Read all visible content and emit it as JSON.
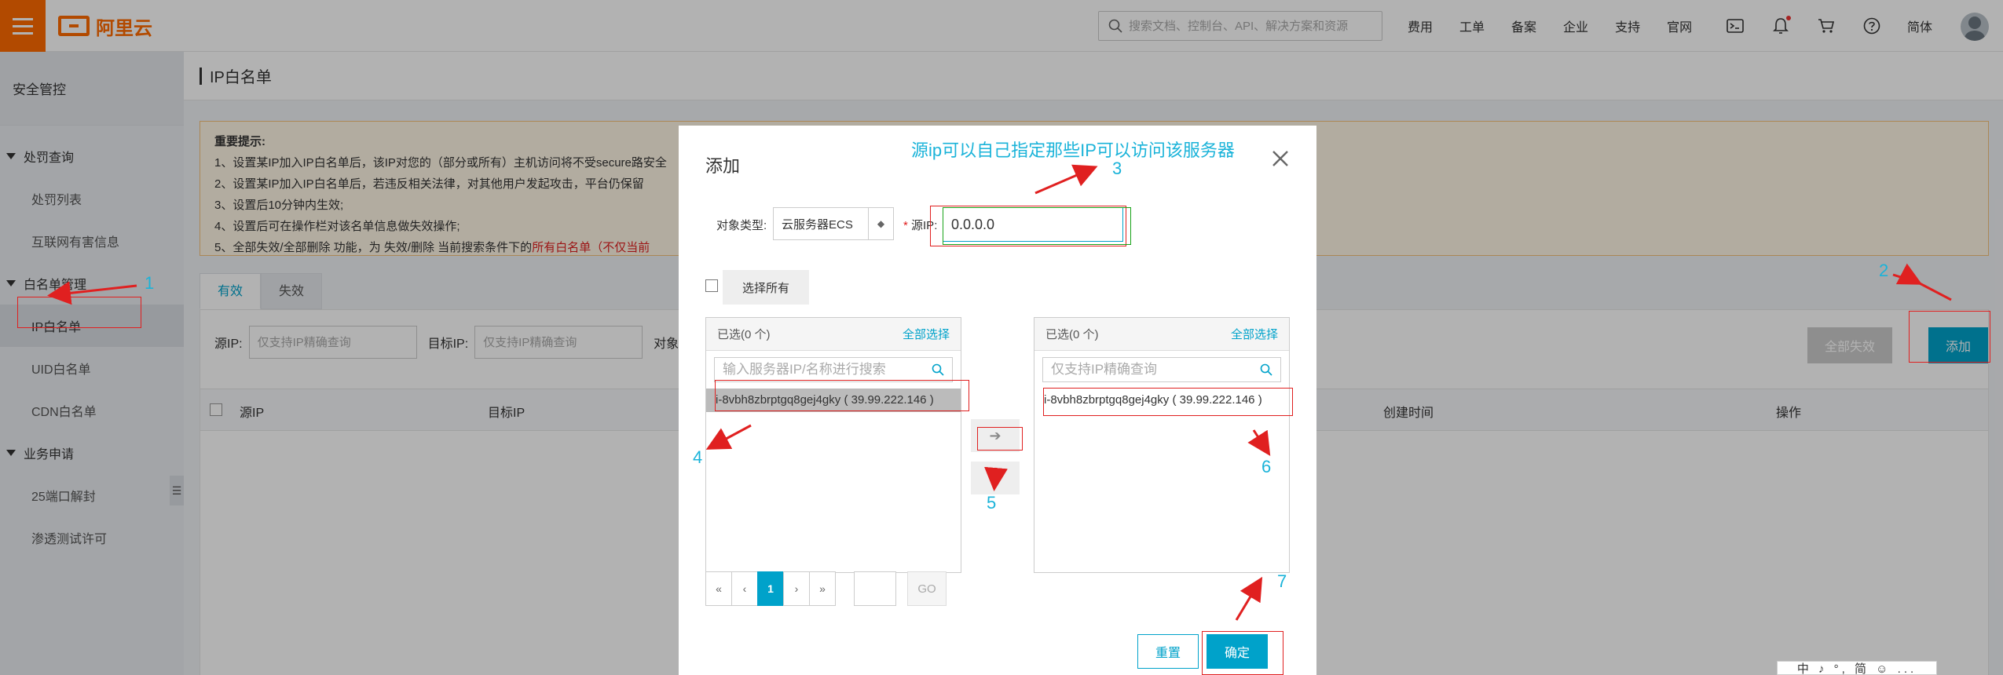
{
  "topbar": {
    "logo_text": "阿里云",
    "search_placeholder": "搜索文档、控制台、API、解决方案和资源",
    "nav": [
      "费用",
      "工单",
      "备案",
      "企业",
      "支持",
      "官网"
    ],
    "lang": "简体",
    "icons": [
      "terminal-icon",
      "bell-icon",
      "cart-icon",
      "help-icon"
    ]
  },
  "sidebar": {
    "title": "安全管控",
    "groups": [
      {
        "label": "处罚查询",
        "items": [
          "处罚列表",
          "互联网有害信息"
        ]
      },
      {
        "label": "白名单管理",
        "items": [
          "IP白名单",
          "UID白名单",
          "CDN白名单"
        ]
      },
      {
        "label": "业务申请",
        "items": [
          "25端口解封",
          "渗透测试许可"
        ]
      }
    ]
  },
  "page": {
    "title": "IP白名单",
    "notice": {
      "title": "重要提示:",
      "lines": [
        "1、设置某IP加入IP白名单后，该IP对您的（部分或所有）主机访问将不受secure路安全",
        "2、设置某IP加入IP白名单后，若违反相关法律，对其他用户发起攻击，平台仍保留",
        "3、设置后10分钟内生效;",
        "4、设置后可在操作栏对该名单信息做失效操作;",
        "5、全部失效/全部删除 功能，为 失效/删除 当前搜索条件下的"
      ],
      "line5_highlight": "所有白名单（不仅当前",
      "line1_text": "1、设置某IP加入IP白名单后，该IP对您的（部分或所有）主机访问将不受secure"
    },
    "tabs": [
      "有效",
      "失效"
    ],
    "filter": {
      "src_label": "源IP:",
      "src_placeholder": "仅支持IP精确查询",
      "dst_label": "目标IP:",
      "dst_placeholder": "仅支持IP精确查询",
      "obj_label": "对象"
    },
    "btn_invalid_all": "全部失效",
    "btn_add": "添加",
    "columns": [
      "源IP",
      "目标IP",
      "创建时间",
      "操作"
    ]
  },
  "dialog": {
    "title": "添加",
    "object_type_label": "对象类型:",
    "object_type_value": "云服务器ECS",
    "src_ip_label": "源IP:",
    "src_ip_value": "0.0.0.0",
    "select_all": "选择所有",
    "left_list": {
      "header": "已选(0 个)",
      "select_all": "全部选择",
      "search_placeholder": "输入服务器IP/名称进行搜索",
      "entry": "i-8vbh8zbrptgq8gej4gky ( 39.99.222.146 )"
    },
    "right_list": {
      "header": "已选(0 个)",
      "select_all": "全部选择",
      "search_placeholder": "仅支持IP精确查询",
      "entry": "i-8vbh8zbrptgq8gej4gky ( 39.99.222.146 )"
    },
    "pager": {
      "first": "«",
      "prev": "‹",
      "current": "1",
      "next": "›",
      "last": "»",
      "go": "GO"
    },
    "btn_reset": "重置",
    "btn_ok": "确定"
  },
  "annotations": {
    "note": "源ip可以自己指定那些IP可以访问该服务器",
    "numbers": [
      "1",
      "2",
      "3",
      "4",
      "5",
      "6",
      "7"
    ],
    "color": "#1ab3d9",
    "box_color": "#e02020"
  },
  "ime_bar": "中 ♪ °, 简 ☺ ..."
}
